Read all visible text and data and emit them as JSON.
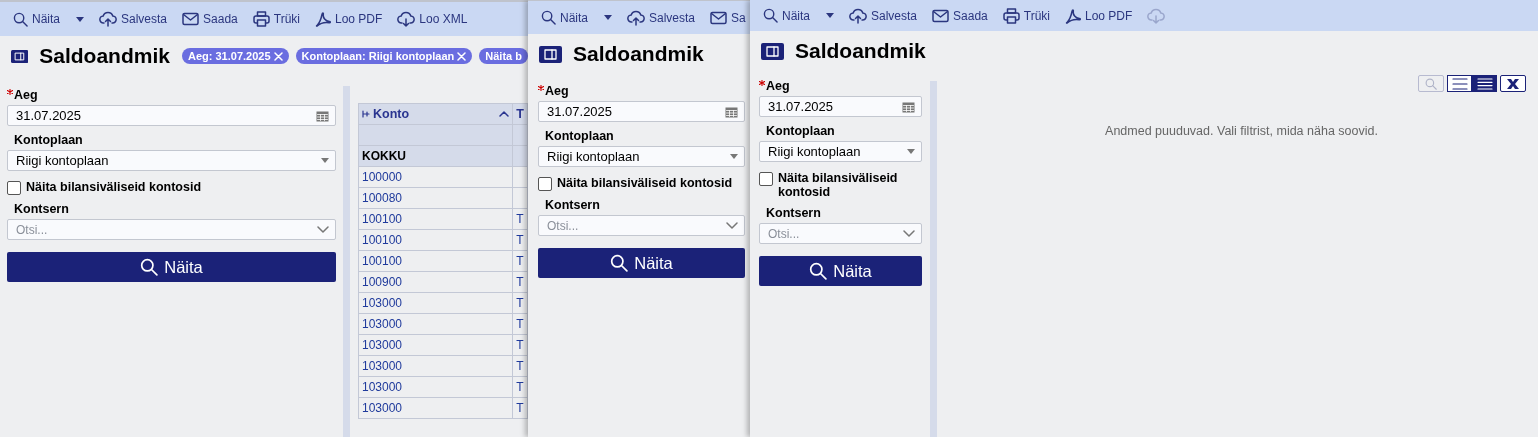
{
  "windows": [
    {
      "toolbar": [
        {
          "kind": "menu",
          "label": "Näita",
          "disabled": false
        },
        {
          "kind": "button",
          "label": "Salvesta",
          "disabled": false
        },
        {
          "kind": "button",
          "label": "Saada",
          "disabled": false
        },
        {
          "kind": "button",
          "label": "Trüki",
          "disabled": false
        },
        {
          "kind": "button",
          "label": "Loo PDF",
          "disabled": false
        },
        {
          "kind": "button",
          "label": "Loo XML",
          "disabled": false
        }
      ],
      "title": "Saldoandmik",
      "chips": [
        {
          "label": "Aeg: 31.07.2025",
          "closable": true
        },
        {
          "label": "Kontoplaan: Riigi kontoplaan",
          "closable": true
        },
        {
          "label": "Näita b",
          "closable": false
        }
      ],
      "filters": {
        "date": {
          "label": "Aeg",
          "required": true,
          "value": "31.07.2025"
        },
        "plan": {
          "label": "Kontoplaan",
          "value": "Riigi kontoplaan"
        },
        "off_balance": {
          "label": "Näita bilansiväliseid kontosid",
          "checked": false
        },
        "group": {
          "label": "Kontsern",
          "placeholder": "Otsi..."
        },
        "submit": {
          "label": "Näita"
        }
      },
      "content": {
        "kind": "table",
        "columns": [
          {
            "label": "Konto",
            "pinned": true,
            "sorted": true
          },
          {
            "label": "T"
          }
        ],
        "rows": [
          {
            "kind": "total",
            "account": "KOKKU"
          },
          {
            "kind": "account",
            "account": "100000"
          },
          {
            "kind": "account",
            "account": "100080"
          },
          {
            "kind": "account",
            "account": "100100",
            "column_2": "T"
          },
          {
            "kind": "account",
            "account": "100100",
            "column_2": "T"
          },
          {
            "kind": "account",
            "account": "100100",
            "column_2": "T"
          },
          {
            "kind": "account",
            "account": "100900",
            "column_2": "T"
          },
          {
            "kind": "account",
            "account": "103000",
            "column_2": "T"
          },
          {
            "kind": "account",
            "account": "103000",
            "column_2": "T"
          },
          {
            "kind": "account",
            "account": "103000",
            "column_2": "T"
          },
          {
            "kind": "account",
            "account": "103000",
            "column_2": "T"
          },
          {
            "kind": "account",
            "account": "103000",
            "column_2": "T"
          },
          {
            "kind": "account",
            "account": "103000",
            "column_2": "T"
          }
        ]
      }
    },
    {
      "toolbar": [
        {
          "kind": "menu",
          "label": "Näita",
          "disabled": false
        },
        {
          "kind": "button",
          "label": "Salvesta",
          "disabled": false
        },
        {
          "kind": "button",
          "label": "Sa",
          "disabled": false
        }
      ],
      "title": "Saldoandmik",
      "filters": {
        "date": {
          "label": "Aeg",
          "required": true,
          "value": "31.07.2025"
        },
        "plan": {
          "label": "Kontoplaan",
          "value": "Riigi kontoplaan"
        },
        "off_balance": {
          "label": "Näita bilansiväliseid kontosid",
          "checked": false
        },
        "group": {
          "label": "Kontsern",
          "placeholder": "Otsi..."
        },
        "submit": {
          "label": "Näita"
        }
      }
    },
    {
      "toolbar": [
        {
          "kind": "menu",
          "label": "Näita",
          "disabled": false
        },
        {
          "kind": "button",
          "label": "Salvesta",
          "disabled": false
        },
        {
          "kind": "button",
          "label": "Saada",
          "disabled": false
        },
        {
          "kind": "button",
          "label": "Trüki",
          "disabled": false
        },
        {
          "kind": "button",
          "label": "Loo PDF",
          "disabled": false
        },
        {
          "kind": "button",
          "disabled": true
        }
      ],
      "title": "Saldoandmik",
      "filters": {
        "date": {
          "label": "Aeg",
          "required": true,
          "value": "31.07.2025"
        },
        "plan": {
          "label": "Kontoplaan",
          "value": "Riigi kontoplaan"
        },
        "off_balance": {
          "label": "Näita bilansiväliseid kontosid",
          "checked": false
        },
        "group": {
          "label": "Kontsern",
          "placeholder": "Otsi..."
        },
        "submit": {
          "label": "Näita"
        }
      },
      "content": {
        "kind": "empty",
        "message": "Andmed puuduvad. Vali filtrist, mida näha soovid.",
        "tools": [
          {
            "kind": "search",
            "disabled": true
          },
          {
            "kind": "list",
            "disabled": false,
            "selected": false
          },
          {
            "kind": "dense-list",
            "disabled": false,
            "selected": true
          },
          {
            "kind": "excel",
            "disabled": false
          }
        ]
      }
    }
  ]
}
